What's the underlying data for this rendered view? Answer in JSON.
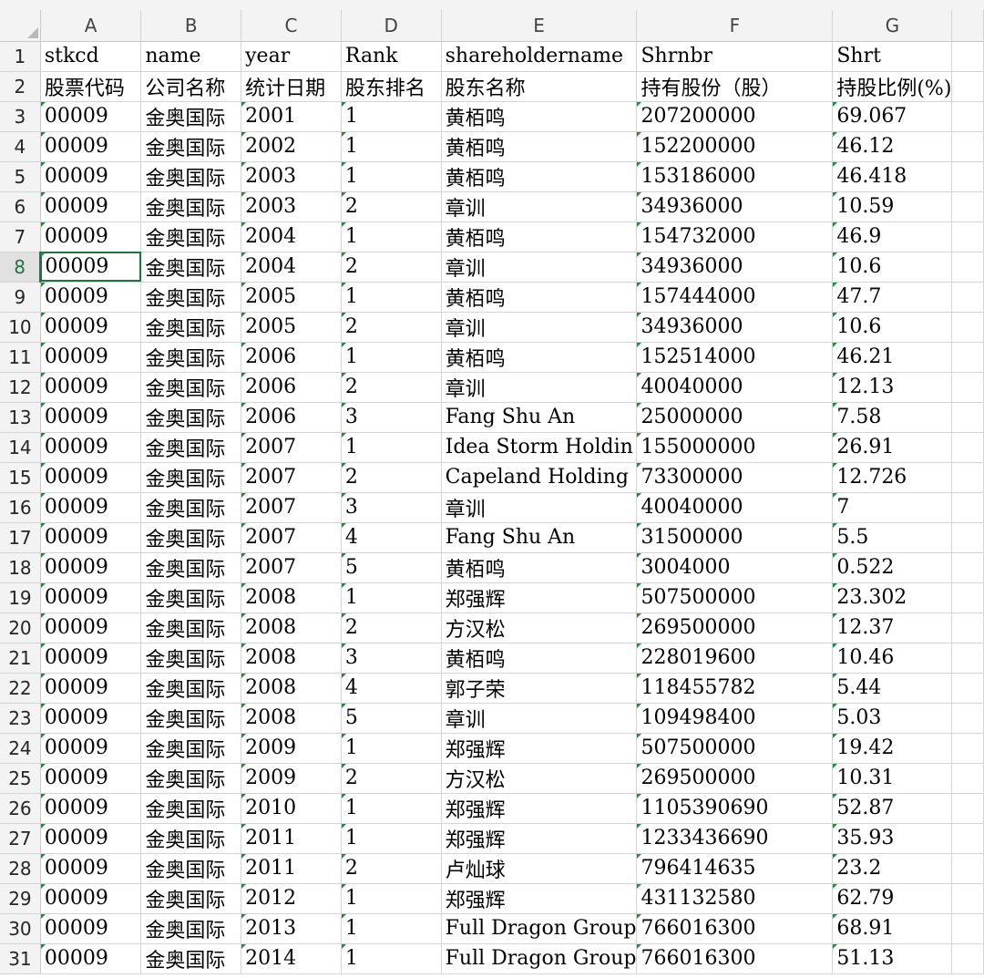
{
  "columns": [
    "A",
    "B",
    "C",
    "D",
    "E",
    "F",
    "G"
  ],
  "header_rows": [
    [
      "stkcd",
      "name",
      "year",
      "Rank",
      "shareholdername",
      "Shrnbr",
      "Shrt"
    ],
    [
      "股票代码",
      "公司名称",
      "统计日期",
      "股东排名",
      "股东名称",
      "持有股份（股）",
      "持股比例(%)"
    ]
  ],
  "data_rows": [
    [
      "00009",
      "金奥国际",
      "2001",
      "1",
      "黄栢鸣",
      "207200000",
      "69.067"
    ],
    [
      "00009",
      "金奥国际",
      "2002",
      "1",
      "黄栢鸣",
      "152200000",
      "46.12"
    ],
    [
      "00009",
      "金奥国际",
      "2003",
      "1",
      "黄栢鸣",
      "153186000",
      "46.418"
    ],
    [
      "00009",
      "金奥国际",
      "2003",
      "2",
      "章训",
      "34936000",
      "10.59"
    ],
    [
      "00009",
      "金奥国际",
      "2004",
      "1",
      "黄栢鸣",
      "154732000",
      "46.9"
    ],
    [
      "00009",
      "金奥国际",
      "2004",
      "2",
      "章训",
      "34936000",
      "10.6"
    ],
    [
      "00009",
      "金奥国际",
      "2005",
      "1",
      "黄栢鸣",
      "157444000",
      "47.7"
    ],
    [
      "00009",
      "金奥国际",
      "2005",
      "2",
      "章训",
      "34936000",
      "10.6"
    ],
    [
      "00009",
      "金奥国际",
      "2006",
      "1",
      "黄栢鸣",
      "152514000",
      "46.21"
    ],
    [
      "00009",
      "金奥国际",
      "2006",
      "2",
      "章训",
      "40040000",
      "12.13"
    ],
    [
      "00009",
      "金奥国际",
      "2006",
      "3",
      "Fang Shu An",
      "25000000",
      "7.58"
    ],
    [
      "00009",
      "金奥国际",
      "2007",
      "1",
      "Idea Storm Holdin",
      "155000000",
      "26.91"
    ],
    [
      "00009",
      "金奥国际",
      "2007",
      "2",
      "Capeland Holding",
      "73300000",
      "12.726"
    ],
    [
      "00009",
      "金奥国际",
      "2007",
      "3",
      "章训",
      "40040000",
      "7"
    ],
    [
      "00009",
      "金奥国际",
      "2007",
      "4",
      "Fang Shu An",
      "31500000",
      "5.5"
    ],
    [
      "00009",
      "金奥国际",
      "2007",
      "5",
      "黄栢鸣",
      "3004000",
      "0.522"
    ],
    [
      "00009",
      "金奥国际",
      "2008",
      "1",
      "郑强辉",
      "507500000",
      "23.302"
    ],
    [
      "00009",
      "金奥国际",
      "2008",
      "2",
      "方汉松",
      "269500000",
      "12.37"
    ],
    [
      "00009",
      "金奥国际",
      "2008",
      "3",
      "黄栢鸣",
      "228019600",
      "10.46"
    ],
    [
      "00009",
      "金奥国际",
      "2008",
      "4",
      "郭子荣",
      "118455782",
      "5.44"
    ],
    [
      "00009",
      "金奥国际",
      "2008",
      "5",
      "章训",
      "109498400",
      "5.03"
    ],
    [
      "00009",
      "金奥国际",
      "2009",
      "1",
      "郑强辉",
      "507500000",
      "19.42"
    ],
    [
      "00009",
      "金奥国际",
      "2009",
      "2",
      "方汉松",
      "269500000",
      "10.31"
    ],
    [
      "00009",
      "金奥国际",
      "2010",
      "1",
      "郑强辉",
      "1105390690",
      "52.87"
    ],
    [
      "00009",
      "金奥国际",
      "2011",
      "1",
      "郑强辉",
      "1233436690",
      "35.93"
    ],
    [
      "00009",
      "金奥国际",
      "2011",
      "2",
      "卢灿球",
      "796414635",
      "23.2"
    ],
    [
      "00009",
      "金奥国际",
      "2012",
      "1",
      "郑强辉",
      "431132580",
      "62.79"
    ],
    [
      "00009",
      "金奥国际",
      "2013",
      "1",
      "Full Dragon Group",
      "766016300",
      "68.91"
    ],
    [
      "00009",
      "金奥国际",
      "2014",
      "1",
      "Full Dragon Group",
      "766016300",
      "51.13"
    ]
  ],
  "active_row": 8,
  "colors": {
    "selection": "#217346",
    "error_flag": "#1e8c3c"
  }
}
